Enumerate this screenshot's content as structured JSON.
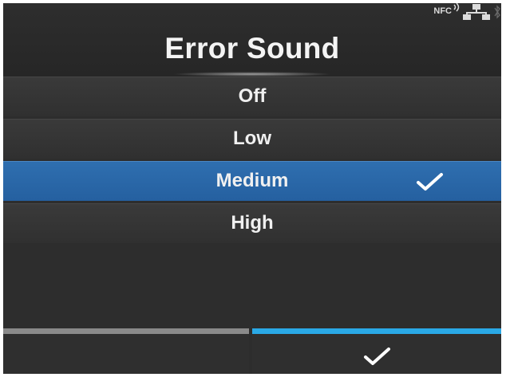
{
  "header": {
    "title": "Error Sound",
    "status_icons": {
      "nfc_label": "NFC",
      "nfc_icon": "nfc-icon",
      "lan_icon": "lan-network-icon",
      "bluetooth_icon": "bluetooth-icon"
    }
  },
  "options": [
    {
      "label": "Off",
      "selected": false
    },
    {
      "label": "Low",
      "selected": false
    },
    {
      "label": "Medium",
      "selected": true
    },
    {
      "label": "High",
      "selected": false
    }
  ],
  "footer": {
    "left_softkey_label": "",
    "right_softkey_icon": "checkmark-icon"
  },
  "colors": {
    "selected_row": "#2a67a8",
    "confirm_accent": "#2aa9e6",
    "idle_accent": "#8a8a8a",
    "background": "#2d2d2d"
  }
}
